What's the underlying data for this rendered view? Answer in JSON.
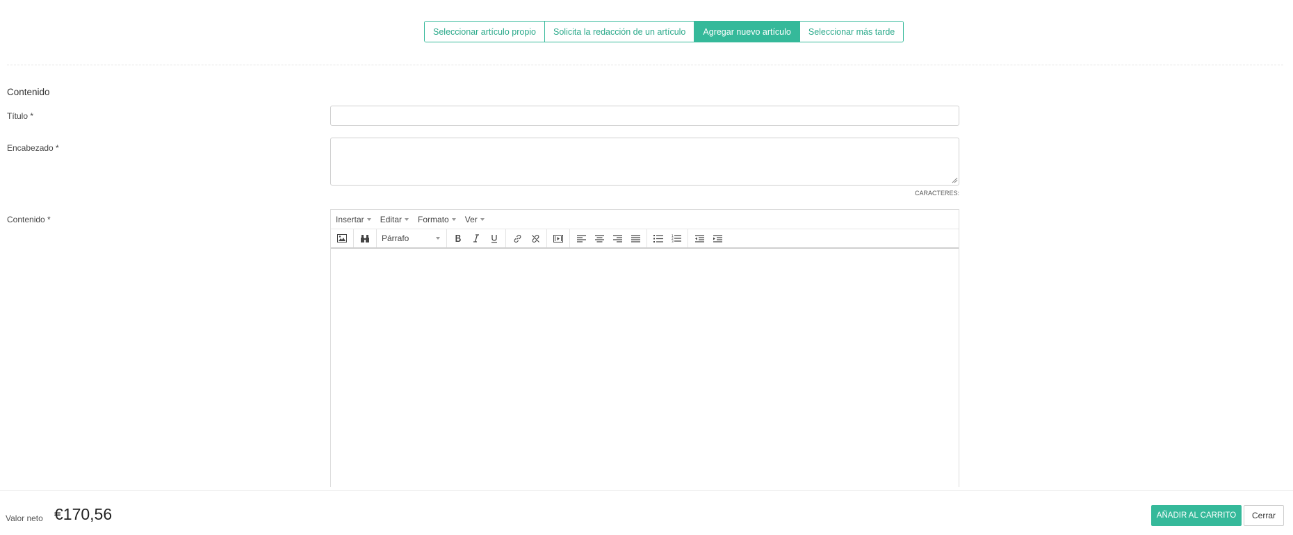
{
  "tabs": [
    {
      "label": "Seleccionar artículo propio",
      "active": false
    },
    {
      "label": "Solicita la redacción de un artículo",
      "active": false
    },
    {
      "label": "Agregar nuevo artículo",
      "active": true
    },
    {
      "label": "Seleccionar más tarde",
      "active": false
    }
  ],
  "form": {
    "section_title": "Contenido",
    "title_label": "Título *",
    "title_value": "",
    "lead_label": "Encabezado *",
    "lead_value": "",
    "char_counter": "CARACTERES:",
    "content_label": "Contenido *"
  },
  "editor": {
    "menus": [
      "Insertar",
      "Editar",
      "Formato",
      "Ver"
    ],
    "format_select": "Párrafo"
  },
  "footer": {
    "net_label": "Valor neto",
    "net_value": "€170,56",
    "add_to_cart": "AÑADIR AL CARRITO",
    "close": "Cerrar"
  },
  "colors": {
    "accent": "#35b99a"
  }
}
